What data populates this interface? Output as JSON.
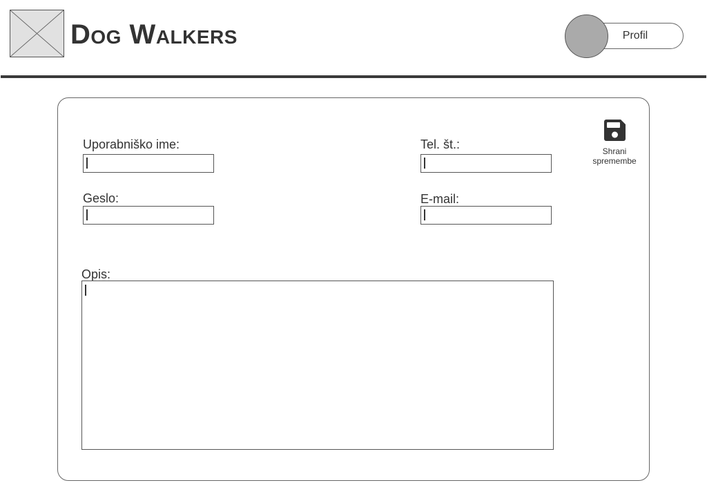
{
  "header": {
    "brand_title": "Dog Walkers",
    "profile_label": "Profil"
  },
  "form": {
    "username_label": "Uporabniško ime:",
    "password_label": "Geslo:",
    "phone_label": "Tel. št.:",
    "email_label": "E-mail:",
    "description_label": "Opis:",
    "username_value": "",
    "password_value": "",
    "phone_value": "",
    "email_value": "",
    "description_value": ""
  },
  "actions": {
    "save_label_line1": "Shrani",
    "save_label_line2": "spremembe",
    "save_icon": "floppy-disk-icon"
  },
  "colors": {
    "divider": "#3a3a3a",
    "avatar": "#aaaaaa",
    "logo_placeholder": "#e1e1e1",
    "icon": "#333333"
  }
}
